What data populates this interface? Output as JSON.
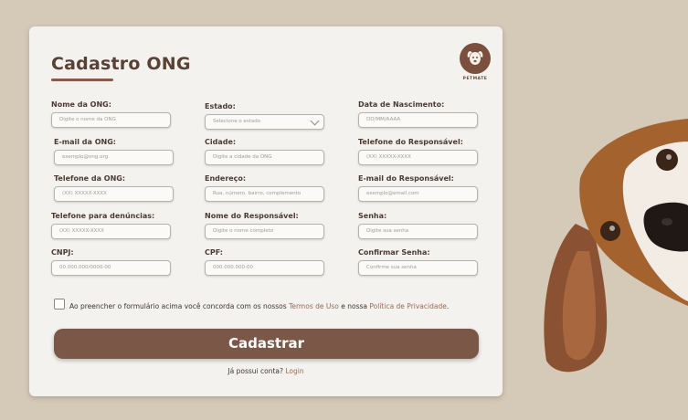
{
  "form": {
    "title": "Cadastro  ONG",
    "logo_text": "PETMATE",
    "fields": [
      {
        "label": "Nome da ONG:",
        "placeholder": "Digite o nome da ONG"
      },
      {
        "label": "Estado:",
        "placeholder": "Selecione o estado"
      },
      {
        "label": "Data de Nascimento:",
        "placeholder": "DD/MM/AAAA"
      },
      {
        "label": "E-mail da ONG:",
        "placeholder": "exemplo@ong.org"
      },
      {
        "label": "Cidade:",
        "placeholder": "Digite a cidade da ONG"
      },
      {
        "label": "Telefone do Responsável:",
        "placeholder": "(XX) XXXXX-XXXX"
      },
      {
        "label": "Telefone da ONG:",
        "placeholder": "(XX) XXXXX-XXXX"
      },
      {
        "label": "Endereço:",
        "placeholder": "Rua, número, bairro, complemento"
      },
      {
        "label": "E-mail do Responsável:",
        "placeholder": "exemplo@email.com"
      },
      {
        "label": "Telefone para denúncias:",
        "placeholder": "(XX) XXXXX-XXXX"
      },
      {
        "label": "Nome do Responsável:",
        "placeholder": "Digite o nome completo"
      },
      {
        "label": "Senha:",
        "placeholder": "Digite sua senha"
      },
      {
        "label": "CNPJ:",
        "placeholder": "00.000.000/0000-00"
      },
      {
        "label": "CPF:",
        "placeholder": "000.000.000-00"
      },
      {
        "label": "Confirmar Senha:",
        "placeholder": "Confirme sua senha"
      }
    ],
    "terms": {
      "prefix": "Ao preencher o formulário acima  você concorda com os nossos ",
      "terms_link": "Termos de Uso",
      "middle": " e nossa ",
      "privacy_link": "Política de Privacidade",
      "suffix": "."
    },
    "submit_label": "Cadastrar",
    "login_prompt": "Já possui conta? ",
    "login_link": "Login"
  },
  "colors": {
    "background": "#d5c9b8",
    "card": "#f4f2ee",
    "accent": "#7b5747",
    "link": "#9a6a52"
  }
}
